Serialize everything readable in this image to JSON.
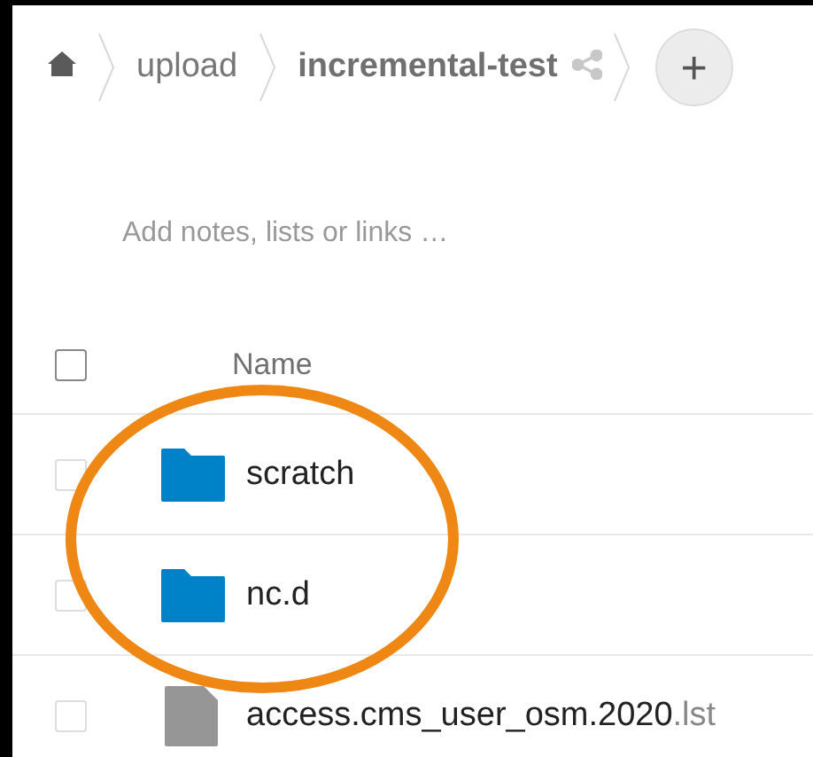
{
  "breadcrumbs": [
    {
      "kind": "home"
    },
    {
      "kind": "folder",
      "label": "upload",
      "current": false
    },
    {
      "kind": "folder",
      "label": "incremental-test",
      "current": true
    }
  ],
  "new_button": {
    "label": "+"
  },
  "notes": {
    "placeholder": "Add notes, lists or links …"
  },
  "table": {
    "select_all": {
      "checked": false
    },
    "columns": [
      "Name"
    ],
    "rows": [
      {
        "kind": "folder",
        "name": "scratch",
        "checked": false
      },
      {
        "kind": "folder",
        "name": "nc.d",
        "checked": false
      },
      {
        "kind": "file",
        "name": "access.cms_user_osm.2020",
        "extension": ".lst",
        "checked": false
      }
    ]
  },
  "annotation": {
    "kind": "ellipse",
    "color": "#ef8714"
  }
}
